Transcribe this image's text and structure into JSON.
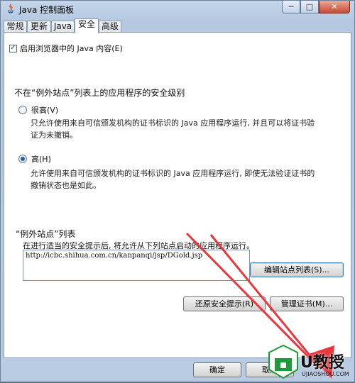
{
  "window": {
    "title": "Java 控制面板",
    "minimize_glyph": "─",
    "maximize_glyph": "□",
    "close_glyph": "✕"
  },
  "tabs": [
    {
      "label": "常规",
      "active": false
    },
    {
      "label": "更新",
      "active": false
    },
    {
      "label": "Java",
      "active": false
    },
    {
      "label": "安全",
      "active": true
    },
    {
      "label": "高级",
      "active": false
    }
  ],
  "security": {
    "enable_java_label": "启用浏览器中的 Java 内容(E)",
    "enable_java_checked": true,
    "level_heading": "不在“例外站点”列表上的应用程序的安全级别",
    "levels": [
      {
        "label": "很高(V)",
        "selected": false,
        "description_line1": "只允许使用来自可信颁发机构的证书标识的 Java 应用程序运行, 并且可以将证书验",
        "description_line2": "证为未撤销。"
      },
      {
        "label": "高(H)",
        "selected": true,
        "description_line1": "允许使用来自可信颁发机构的证书标识的 Java 应用程序运行, 即使无法验证证书的",
        "description_line2": "撤销状态也是如此。"
      }
    ],
    "exception_sites_heading": "“例外站点”列表",
    "exception_sites_note": "在进行适当的安全提示后, 将允许从下列站点启动的应用程序运行。",
    "exception_sites": [
      "http://icbc.shihua.com.cn/kanpanqi/jsp/DGold.jsp"
    ],
    "edit_sites_button": "编辑站点列表(S)...",
    "restore_prompts_button": "还原安全提示(R)",
    "manage_certs_button": "管理证书(M)..."
  },
  "footer": {
    "ok_button": "确定",
    "cancel_button": "取消"
  },
  "watermark": {
    "brand": "U教授",
    "domain": "UJIAOSHOU.COM"
  },
  "colors": {
    "arrow": "#e8383d",
    "watermark_green": "#1f9a3a"
  }
}
